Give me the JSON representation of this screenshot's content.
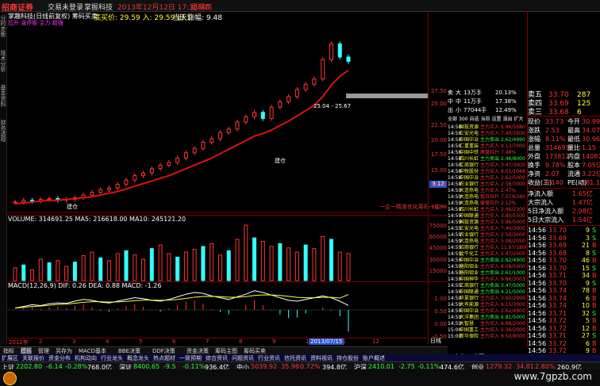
{
  "app": {
    "logo": "招商证券",
    "menu": [
      "交易未登录",
      "掌握科技"
    ],
    "datetime": "2013年12月12日 17:35:40",
    "weekday": "星期四"
  },
  "left_tabs": [
    "分时走势",
    "技术分析",
    "基本资料",
    "财务透视"
  ],
  "chart": {
    "title": "掌趣科技(日线前复权) 筹码买卖",
    "indicator_line": "底买价: 29.59 入: 29.59 出:1",
    "indicator_line2": "当天涨幅: 9.48",
    "subtitle": "拉升 涨停板 主力 超强",
    "price_label": "25.04 - 25.67",
    "marker_label": "建仓",
    "marker_label2": "建仓",
    "watermark_text": "一企一精准优化筹码一企一",
    "volume_title": "VOLUME: 314691.25  MA5: 216618.00  MA10: 245121.20",
    "macd_title": "MACD(12,26,9)  DIF: 0.26  DEA: 0.88  MACD: -1.26",
    "date_highlight": "2013/07/15",
    "year_label": "2012年",
    "month_ticks": [
      "2",
      "3",
      "4",
      "5",
      "6",
      "7",
      "8",
      "9",
      "10",
      "11",
      "12"
    ],
    "price_axis": [
      "27.50",
      "25.00",
      "22.50",
      "20.00",
      "17.50",
      "15.00",
      "12.50",
      "10.00",
      "9.12"
    ],
    "vol_axis": [
      "75000",
      "60000",
      "45000",
      "30000",
      "15000"
    ],
    "macd_axis": [
      "1.00",
      "0.50",
      "0.00",
      "-0.50"
    ]
  },
  "chart_data": {
    "type": "line",
    "price_series": [
      9.0,
      9.2,
      9.1,
      9.3,
      9.4,
      9.2,
      9.3,
      9.5,
      9.8,
      10.1,
      10.4,
      10.6,
      11.0,
      11.5,
      12.0,
      12.3,
      12.8,
      13.2,
      13.5,
      14.0,
      14.6,
      15.1,
      15.8,
      16.2,
      16.9,
      17.3,
      18.1,
      18.7,
      19.2,
      18.5,
      19.8,
      20.4,
      21.0,
      21.8,
      22.4,
      23.0,
      25.2,
      27.0,
      25.5,
      25.0
    ],
    "ma_series": [
      8.8,
      8.9,
      9.0,
      9.1,
      9.2,
      9.2,
      9.3,
      9.4,
      9.5,
      9.6,
      9.8,
      10.0,
      10.2,
      10.5,
      10.8,
      11.1,
      11.4,
      11.7,
      12.0,
      12.4,
      12.8,
      13.2,
      13.6,
      14.0,
      14.5,
      15.0,
      15.5,
      16.0,
      16.5,
      16.8,
      17.2,
      17.7,
      18.2,
      18.8,
      19.4,
      20.0,
      21.0,
      22.3,
      23.3,
      24.0
    ],
    "volume": [
      18,
      22,
      15,
      30,
      25,
      28,
      20,
      26,
      35,
      40,
      32,
      28,
      38,
      42,
      36,
      30,
      45,
      50,
      38,
      33,
      40,
      44,
      48,
      52,
      36,
      42,
      58,
      78,
      60,
      55,
      48,
      52,
      46,
      40,
      50,
      45,
      62,
      58,
      40,
      38
    ],
    "macd_dif": [
      0.1,
      0.2,
      0.3,
      0.25,
      0.35,
      0.4,
      0.38,
      0.5,
      0.6,
      0.55,
      0.45,
      0.4,
      0.5,
      0.6,
      0.7,
      0.65,
      0.55,
      0.5,
      0.6,
      0.75,
      0.9,
      1.0,
      0.95,
      0.8,
      0.7,
      0.6,
      0.75,
      0.9,
      1.1,
      1.0,
      0.85,
      0.7,
      0.55,
      0.5,
      0.6,
      0.7,
      0.8,
      0.7,
      0.5,
      0.26
    ],
    "macd_dea": [
      0.1,
      0.15,
      0.2,
      0.22,
      0.27,
      0.31,
      0.33,
      0.38,
      0.44,
      0.47,
      0.47,
      0.45,
      0.46,
      0.49,
      0.53,
      0.56,
      0.56,
      0.55,
      0.56,
      0.6,
      0.66,
      0.73,
      0.77,
      0.78,
      0.76,
      0.73,
      0.73,
      0.76,
      0.83,
      0.86,
      0.86,
      0.83,
      0.78,
      0.72,
      0.7,
      0.7,
      0.72,
      0.72,
      0.68,
      0.88
    ],
    "ylim": [
      8,
      30
    ]
  },
  "quote": {
    "sell_levels": [
      {
        "name": "卖五",
        "price": "33.70",
        "vol": "287"
      },
      {
        "name": "卖四",
        "price": "33.69",
        "vol": "125"
      },
      {
        "name": "卖三",
        "price": "33.68",
        "vol": "6"
      }
    ],
    "stats": [
      {
        "k": "现价",
        "v": "33.73",
        "k2": "今开",
        "v2": "30.99"
      },
      {
        "k": "涨跌",
        "v": "2.53",
        "k2": "最高",
        "v2": "34.07"
      },
      {
        "k": "涨幅",
        "v": "8.11%",
        "k2": "最低",
        "v2": "30.96"
      },
      {
        "k": "总量",
        "v": "314691",
        "k2": "量比",
        "v2": "1.15"
      },
      {
        "k": "外盘",
        "v": "173812",
        "k2": "内盘",
        "v2": "140879"
      },
      {
        "k": "换手",
        "v": "9.78%",
        "k2": "股本",
        "v2": "7.05亿"
      },
      {
        "k": "净资",
        "v": "2.07",
        "k2": "流通",
        "v2": "3.22亿"
      },
      {
        "k": "收益(三)",
        "v": "0.140",
        "k2": "PE(动)",
        "v2": "181.1"
      }
    ],
    "flows": [
      {
        "k": "净流入额",
        "v": "1.65亿"
      },
      {
        "k": "大宗流入",
        "v": "1.47亿"
      },
      {
        "k": "5日净流入额",
        "v": "2.98亿"
      },
      {
        "k": "5日大宗流入",
        "v": "1.54亿"
      }
    ],
    "ticks": [
      {
        "t": "14:56",
        "p": "33.70",
        "v": "9",
        "d": "S"
      },
      {
        "t": "14:56",
        "p": "33.69",
        "v": "3",
        "d": "S"
      },
      {
        "t": "14:56",
        "p": "33.69",
        "v": "21",
        "d": "B"
      },
      {
        "t": "14:56",
        "p": "33.68",
        "v": "8",
        "d": "S"
      },
      {
        "t": "14:56",
        "p": "33.70",
        "v": "46",
        "d": "B"
      },
      {
        "t": "14:56",
        "p": "33.70",
        "v": "15",
        "d": "S"
      },
      {
        "t": "14:56",
        "p": "33.71",
        "v": "34",
        "d": "B"
      },
      {
        "t": "14:56",
        "p": "33.70",
        "v": "9",
        "d": "S"
      },
      {
        "t": "14:56",
        "p": "33.74",
        "v": "78",
        "d": "B"
      },
      {
        "t": "14:56",
        "p": "33.74",
        "v": "6",
        "d": "B"
      },
      {
        "t": "14:56",
        "p": "33.74",
        "v": "10",
        "d": "B"
      },
      {
        "t": "14:56",
        "p": "33.71",
        "v": "32",
        "d": "S"
      },
      {
        "t": "14:56",
        "p": "33.72",
        "v": "5",
        "d": "B"
      },
      {
        "t": "14:56",
        "p": "33.72",
        "v": "12",
        "d": "B"
      },
      {
        "t": "14:56",
        "p": "33.71",
        "v": "27",
        "d": "S"
      },
      {
        "t": "14:56",
        "p": "33.72",
        "v": "6",
        "d": "B"
      },
      {
        "t": "14:56",
        "p": "33.72",
        "v": "9",
        "d": "B"
      },
      {
        "t": "14:56",
        "p": "33.73",
        "v": "5",
        "d": "B"
      },
      {
        "t": "14:56",
        "p": "33.73",
        "v": "24",
        "d": "B"
      },
      {
        "t": "15:00",
        "p": "33.73",
        "v": "3195",
        "d": ""
      }
    ],
    "bottom_tabs": [
      "主力",
      "分页"
    ]
  },
  "board": {
    "header": [
      "全部",
      "300",
      "自选",
      "当前",
      "设置",
      "涨出",
      "扩大"
    ],
    "buy_levels": [
      {
        "name": "卖",
        "price": "大",
        "label": "13万手",
        "pct": "20.13%"
      },
      {
        "name": "中",
        "price": "中",
        "label": "11万手",
        "pct": "17.38%"
      },
      {
        "name": "出",
        "price": "小",
        "label": "77044手",
        "pct": "12.49%"
      }
    ],
    "rows": [
      {
        "t": "14:58",
        "n": "国投资源",
        "a": "主力买入",
        "v": "5.96/5080"
      },
      {
        "t": "14:58",
        "n": "三安光电",
        "a": "主力买入",
        "v": "7.40/3500"
      },
      {
        "t": "14:58",
        "n": "中国中冶",
        "a": "主力卖出",
        "v": "2.62/4990"
      },
      {
        "t": "14:58",
        "n": "二重重装",
        "a": "主力买入",
        "v": "4.13/7000"
      },
      {
        "t": "14:58",
        "n": "中国中铁",
        "a": "尾盘拉升",
        "v": "7.48%"
      },
      {
        "t": "14:58",
        "n": "四川长虹",
        "a": "主力卖出",
        "v": "2.46/8000"
      },
      {
        "t": "14:58",
        "n": "工商银行",
        "a": "主力买入",
        "v": "3.47/3000"
      },
      {
        "t": "14:58",
        "n": "中牧股份",
        "a": "主力买入",
        "v": "8.01/1048"
      },
      {
        "t": "14:58",
        "n": "中国中冶",
        "a": "主力买入",
        "v": "2.62/5000"
      },
      {
        "t": "14:58",
        "n": "农业银行",
        "a": "主力买入",
        "v": "2.56/3000"
      },
      {
        "t": "14:59",
        "n": "大连热电",
        "a": "主力买入",
        "v": "2.47%"
      },
      {
        "t": "14:59",
        "n": "大连热电",
        "a": "低位拉升",
        "v": "7.07/6340"
      },
      {
        "t": "14:59",
        "n": "大连热电",
        "a": "缓慢拉升",
        "v": "2.12%"
      },
      {
        "t": "14:59",
        "n": "四川长虹",
        "a": "主力买入",
        "v": "2.46/2300"
      },
      {
        "t": "14:59",
        "n": "中国联通",
        "a": "主力买入",
        "v": "3.80/5500"
      },
      {
        "t": "14:59",
        "n": "国投资源",
        "a": "主力买入",
        "v": "5.96/5000"
      },
      {
        "t": "14:59",
        "n": "三安光电",
        "a": "主力买入",
        "v": "7.40/3000"
      },
      {
        "t": "14:59",
        "n": "农业银行",
        "a": "主力买入",
        "v": "2.56/3000"
      },
      {
        "t": "14:59",
        "n": "大连热电",
        "a": "主力买入",
        "v": "5.08/2050"
      },
      {
        "t": "14:59",
        "n": "招商银行",
        "a": "主力买入",
        "v": "11.97/1800"
      },
      {
        "t": "14:59",
        "n": "金牛化工",
        "a": "主力买入",
        "v": "5.47/2000"
      },
      {
        "t": "14:59",
        "n": "中国中冶",
        "a": "主力卖出",
        "v": "2.62/4900"
      },
      {
        "t": "14:59",
        "n": "洛阳钼业",
        "a": "主力买入",
        "v": "8.08/5000"
      },
      {
        "t": "14:59",
        "n": "洛阳钼业",
        "a": "主力卖出",
        "v": "2.61/1000"
      },
      {
        "t": "14:59",
        "n": "中国神华",
        "a": "主力买入",
        "v": "9.86/3003"
      },
      {
        "t": "14:59",
        "n": "工商银行",
        "a": "主力卖出",
        "v": "3.47/5000"
      },
      {
        "t": "14:59",
        "n": "中国联通",
        "a": "主力卖出",
        "v": "4.21/5000"
      },
      {
        "t": "14:59",
        "n": "华夏银行",
        "a": "主力买入",
        "v": "3.60/2999"
      },
      {
        "t": "14:59",
        "n": "大有能源",
        "a": "主力买入",
        "v": "6.15/3000"
      },
      {
        "t": "14:59",
        "n": "中国中冶",
        "a": "主力买入",
        "v": "2.62/4900"
      },
      {
        "t": "14:59",
        "n": "大洋集团",
        "a": "主力卖出",
        "v": "6.81/5000"
      },
      {
        "t": "14:59",
        "n": "大智慧",
        "a": "主力买入",
        "v": "6.98/2000"
      },
      {
        "t": "15:00",
        "n": "中国重工",
        "a": "主力买入",
        "v": "5.36/2000"
      },
      {
        "t": "15:00",
        "n": "新华保险",
        "a": "主力买入",
        "v": "8.50/8000"
      }
    ],
    "tab_label": "短线精灵"
  },
  "bottom_tabs": [
    "指标",
    "模板",
    "管理",
    "另存为",
    "MACD基本",
    "BBE决策",
    "DDF决策",
    "资金决策",
    "筹码主图",
    "筹码买卖"
  ],
  "bottom_tabs2": [
    "扩展区",
    "关联报价",
    "资金分布",
    "机构动向",
    "行业龙头",
    "概念龙头",
    "热点题材",
    "一致预期",
    "综合资讯",
    "问题资讯",
    "行业资讯",
    "信托资讯",
    "资料视讯",
    "持仓股份",
    "账户概述"
  ],
  "status": [
    {
      "k": "上证",
      "v": "2202.80",
      "c": "-6.14",
      "p": "-0.28%",
      "a": "768.0亿",
      "cls": "green"
    },
    {
      "k": "深证",
      "v": "8400.65",
      "c": "-9.5",
      "p": "-0.11%",
      "a": "936.4亿",
      "cls": "green"
    },
    {
      "k": "中小",
      "v": "5039.92",
      "c": "35.98",
      "p": "0.72%",
      "a": "394.8亿",
      "cls": "red"
    },
    {
      "k": "沪深",
      "v": "2410.01",
      "c": "-2.75",
      "p": "-0.11%",
      "a": "474.6亿",
      "cls": "green"
    },
    {
      "k": "创业",
      "v": "1279.32",
      "c": "34.81",
      "p": "2.80%",
      "a": "260.9亿",
      "cls": "red"
    }
  ],
  "watermark": "www.7gpzb.com",
  "side_tabs": [
    "日线"
  ]
}
